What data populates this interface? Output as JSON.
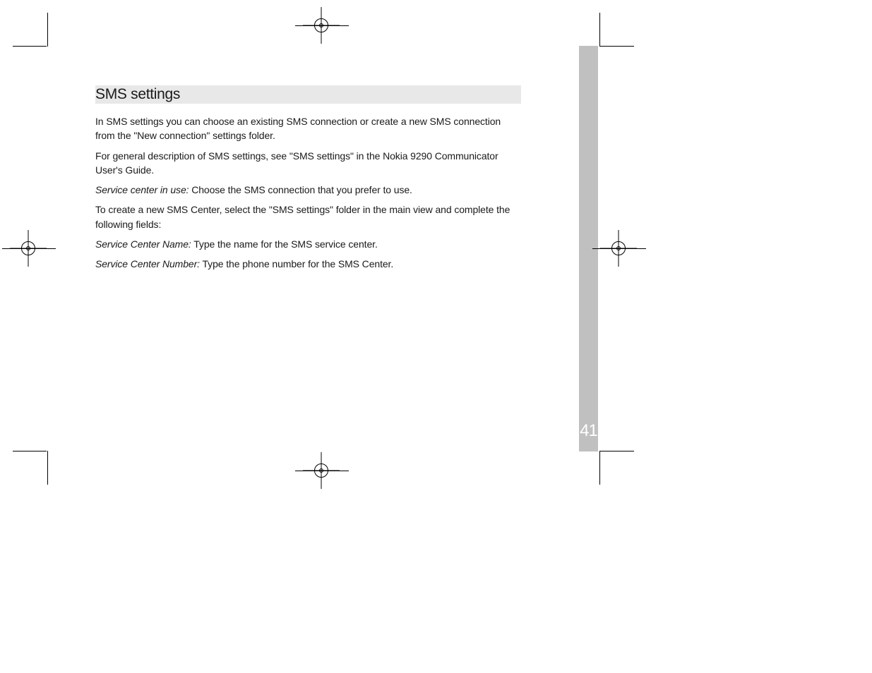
{
  "page_number": "41",
  "heading": "SMS settings",
  "paragraphs": {
    "intro": "In SMS settings you can choose an existing SMS connection or create a new SMS connection from the \"New connection\" settings folder.",
    "general": "For general description of SMS settings, see \"SMS settings\" in the Nokia 9290 Communicator User's Guide.",
    "service_center_in_use_label": "Service center in use:",
    "service_center_in_use_text": " Choose the SMS connection that you prefer to use.",
    "create_new": "To create a new SMS Center, select the \"SMS settings\" folder in the main view and complete the following fields:",
    "service_center_name_label": "Service Center Name:",
    "service_center_name_text": " Type the name for the SMS service center.",
    "service_center_number_label": "Service Center Number:",
    "service_center_number_text": " Type the phone number for the SMS Center."
  }
}
